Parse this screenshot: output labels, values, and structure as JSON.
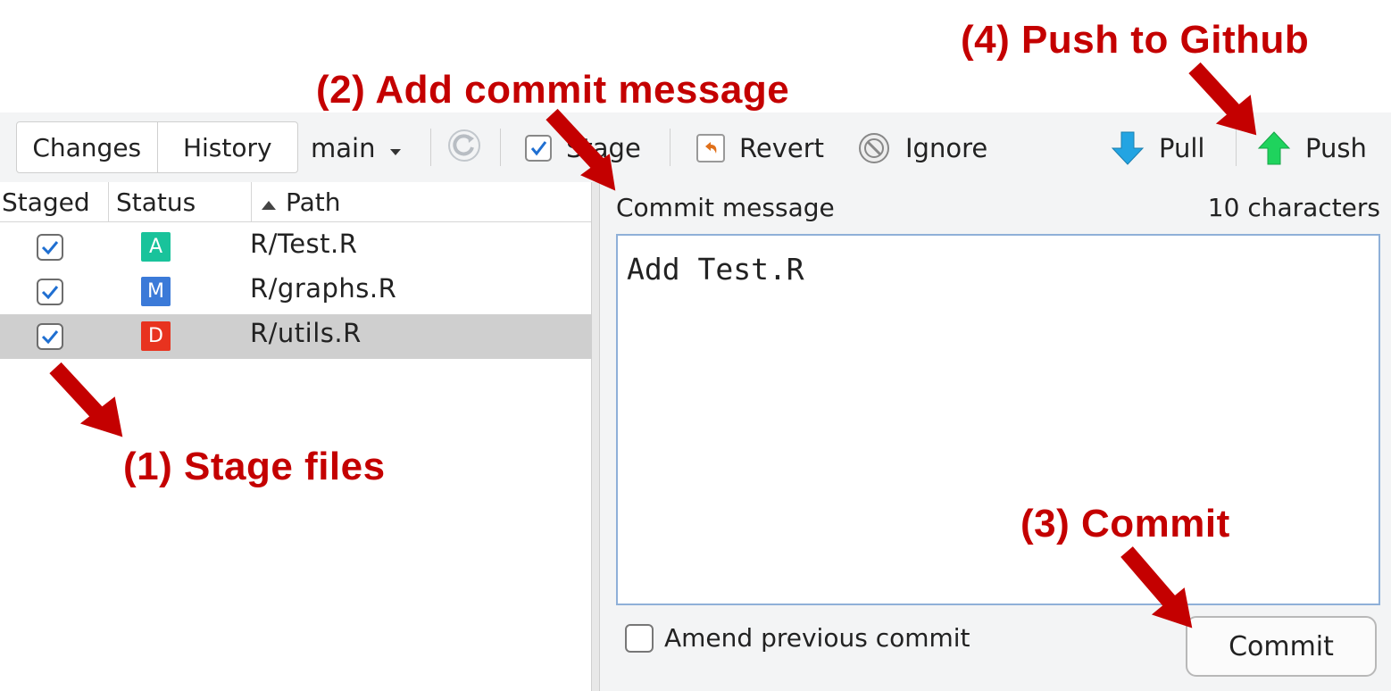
{
  "annotations": {
    "step1": "(1) Stage files",
    "step2": "(2) Add commit message",
    "step3": "(3) Commit",
    "step4": "(4) Push to Github",
    "color": "#c40000"
  },
  "toolbar": {
    "tabs": [
      "Changes",
      "History"
    ],
    "branch": "main",
    "branch_icon": "chevron-down-icon",
    "refresh_icon": "refresh-icon",
    "stage_label": "Stage",
    "revert_label": "Revert",
    "ignore_label": "Ignore",
    "pull_label": "Pull",
    "push_label": "Push"
  },
  "file_list": {
    "columns": [
      "Staged",
      "Status",
      "Path"
    ],
    "sort_icon": "sort-asc-icon",
    "rows": [
      {
        "staged": true,
        "status": "A",
        "status_color": "#19c39b",
        "path": "R/Test.R"
      },
      {
        "staged": true,
        "status": "M",
        "status_color": "#3b7ad8",
        "path": "R/graphs.R"
      },
      {
        "staged": true,
        "status": "D",
        "status_color": "#e8331f",
        "path": "R/utils.R",
        "selected": true
      }
    ]
  },
  "commit": {
    "label": "Commit message",
    "char_count": "10 characters",
    "message": "Add Test.R",
    "amend_label": "Amend previous commit",
    "amend_checked": false,
    "button_label": "Commit"
  }
}
